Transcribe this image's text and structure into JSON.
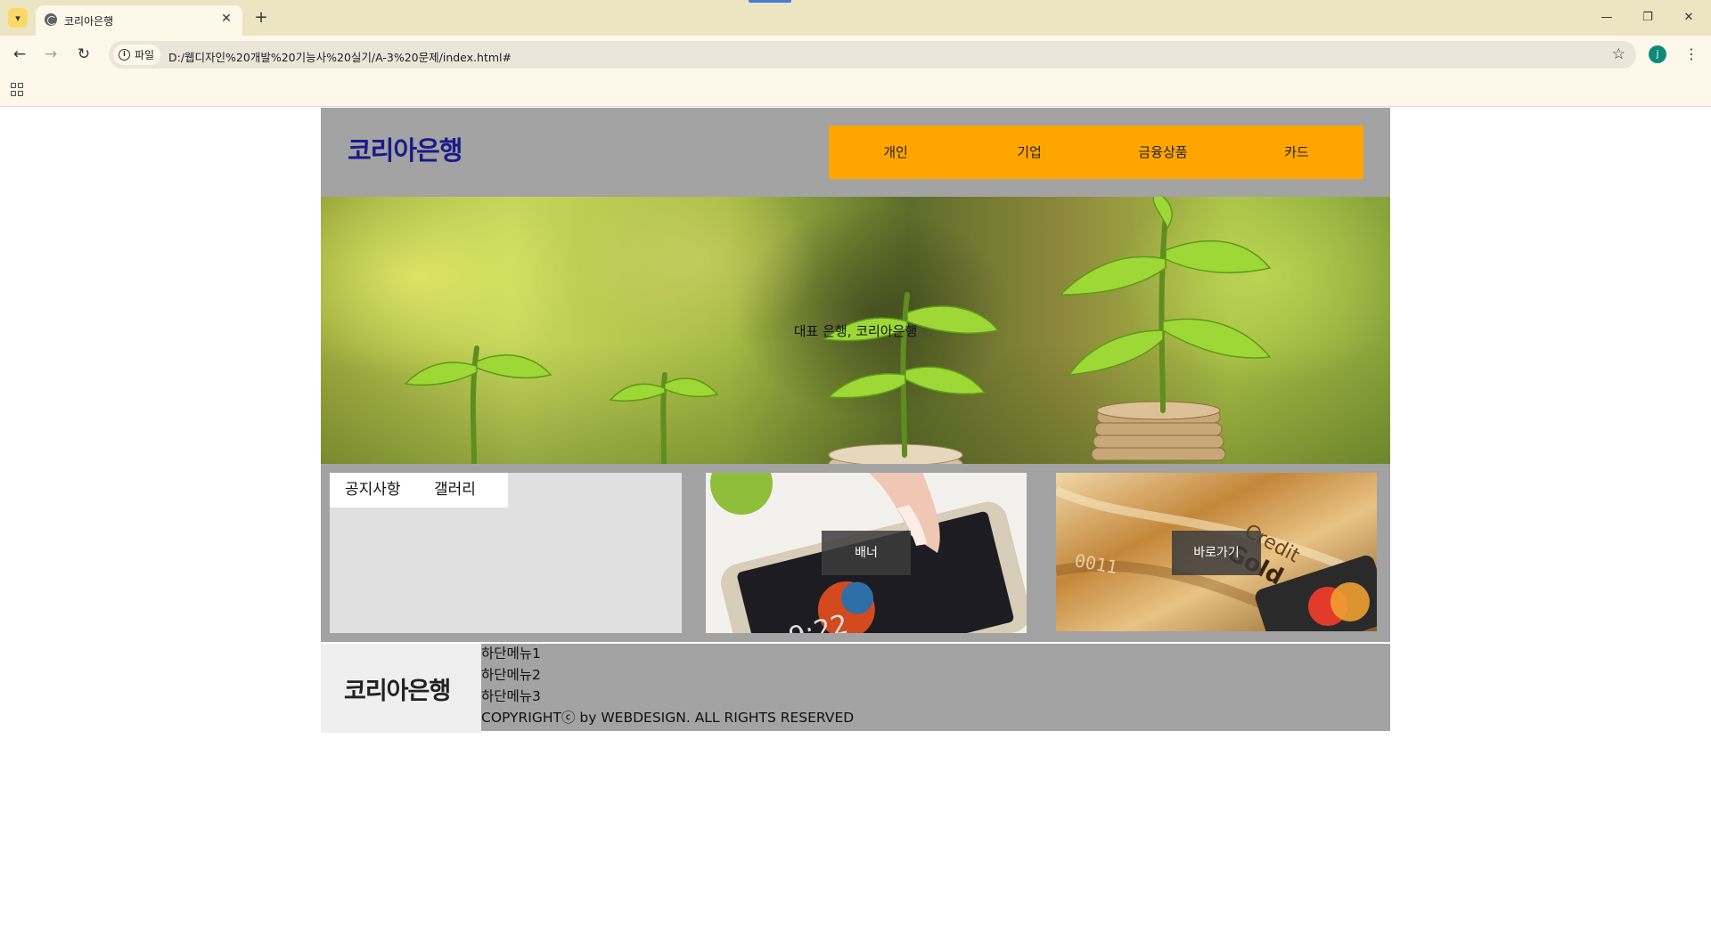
{
  "browser": {
    "tab_title": "코리아은행",
    "site_chip_label": "파일",
    "url": "D:/웹디자인%20개발%20기능사%20실기/A-3%20문제/index.html#",
    "profile_initial": "j",
    "icons": {
      "tab_list": "chevron-down-icon",
      "favicon": "globe-icon",
      "close": "close-icon",
      "new_tab": "plus-icon",
      "back": "arrow-left-icon",
      "forward": "arrow-right-icon",
      "reload": "reload-icon",
      "bookmark": "star-icon",
      "menu": "more-vert-icon",
      "apps": "apps-grid-icon"
    }
  },
  "site": {
    "header": {
      "logo": "코리아은행",
      "nav": [
        "개인",
        "기업",
        "금융상품",
        "카드"
      ]
    },
    "hero": {
      "caption": "대표 은행, 코리아은행"
    },
    "contents": {
      "board_tabs": [
        "공지사항",
        "갤러리"
      ],
      "banner_label": "배너",
      "shortcut_label": "바로가기"
    },
    "footer": {
      "logo": "코리아은행",
      "menu": [
        "하단메뉴1",
        "하단메뉴2",
        "하단메뉴3"
      ],
      "copyright": "COPYRIGHTⓒ by WEBDESIGN. ALL RIGHTS RESERVED"
    }
  },
  "colors": {
    "header_bg": "#a3a3a3",
    "nav_bg": "#ffa500",
    "logo": "#1a1a8a",
    "board_bg": "#e0e0e0"
  }
}
